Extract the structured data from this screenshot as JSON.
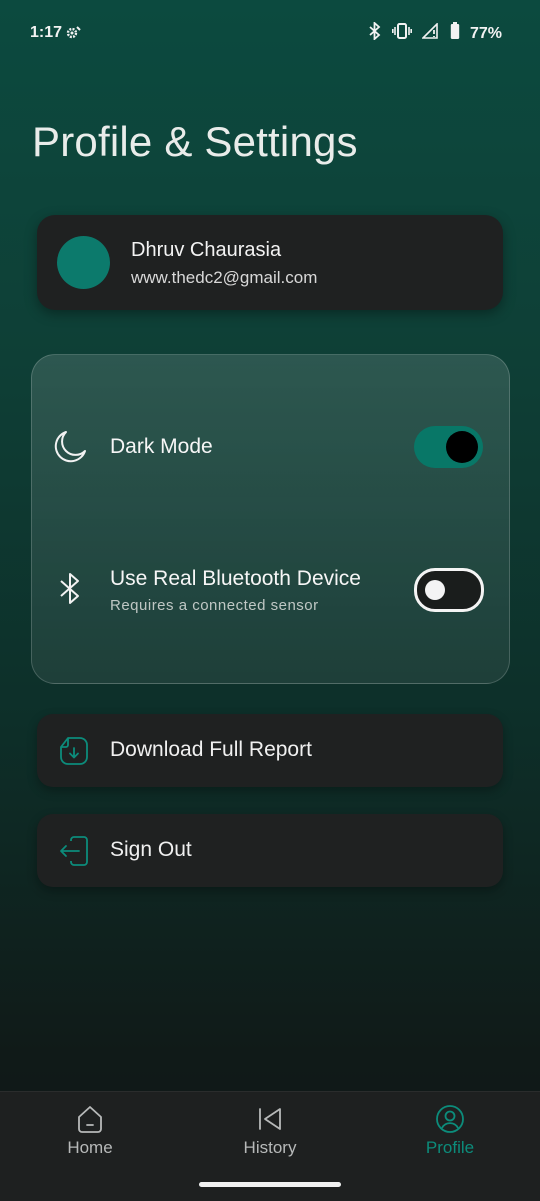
{
  "status_bar": {
    "time": "1:17",
    "battery": "77%",
    "icons": [
      "settings-gear-icon",
      "bluetooth-icon",
      "vibrate-icon",
      "signal-icon",
      "battery-icon"
    ]
  },
  "page": {
    "title": "Profile & Settings"
  },
  "profile": {
    "name": "Dhruv Chaurasia",
    "email": "www.thedc2@gmail.com",
    "avatar_color": "#0c7a6c"
  },
  "settings": {
    "dark_mode": {
      "label": "Dark Mode",
      "enabled": true,
      "icon": "moon-icon"
    },
    "bluetooth": {
      "label": "Use Real Bluetooth Device",
      "subtitle": "Requires a connected sensor",
      "enabled": false,
      "icon": "bluetooth-icon"
    }
  },
  "actions": {
    "download": {
      "label": "Download Full Report",
      "icon": "download-file-icon"
    },
    "signout": {
      "label": "Sign Out",
      "icon": "sign-out-icon"
    }
  },
  "nav": {
    "items": [
      {
        "label": "Home",
        "icon": "home-icon",
        "active": false
      },
      {
        "label": "History",
        "icon": "history-back-icon",
        "active": false
      },
      {
        "label": "Profile",
        "icon": "profile-icon",
        "active": true
      }
    ]
  },
  "colors": {
    "accent": "#0c8c7b",
    "card": "#1f2121",
    "toggle_on": "#087767"
  }
}
